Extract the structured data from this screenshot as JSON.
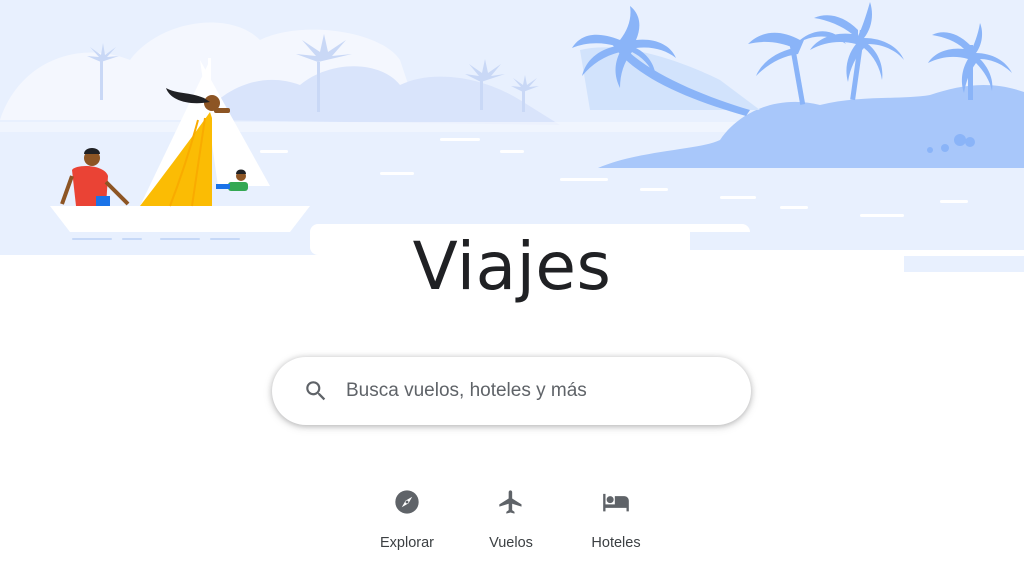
{
  "hero": {
    "illustration": "beach-sailboat-illustration",
    "colors": {
      "sky": "#e8f0fe",
      "island": "#a8c7fa",
      "palm": "#8ab4f8",
      "sail_dress": "#fbbc04",
      "shirt": "#ea4335"
    }
  },
  "page_title": "Viajes",
  "search": {
    "placeholder": "Busca vuelos, hoteles y más",
    "icon": "search-icon"
  },
  "nav": [
    {
      "label": "Explorar",
      "icon": "compass-icon"
    },
    {
      "label": "Vuelos",
      "icon": "airplane-icon"
    },
    {
      "label": "Hoteles",
      "icon": "bed-icon"
    }
  ]
}
